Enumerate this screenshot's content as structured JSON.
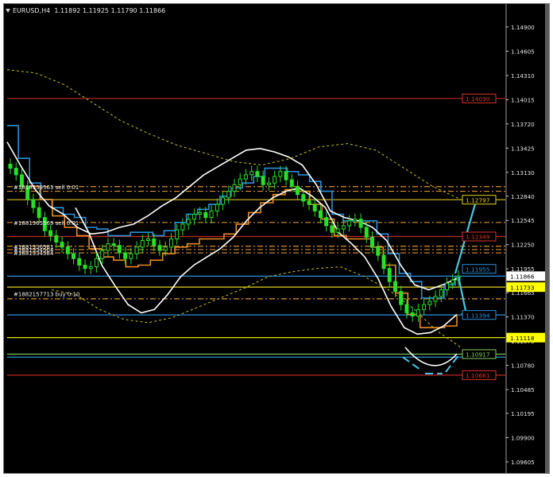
{
  "title_bar": {
    "symbol_label": "EURUSD,H4",
    "ohlc": "1.11892 1.11925 1.11790 1.11866"
  },
  "chart_data": {
    "type": "line",
    "title": "EURUSD,H4  1.11892 1.11925 1.11790 1.11866",
    "ylim": [
      1.0945,
      1.1518
    ],
    "grid": false,
    "background": "#000000",
    "y_ticks": [
      "1.14900",
      "1.14605",
      "1.14310",
      "1.14015",
      "1.13720",
      "1.13425",
      "1.13130",
      "1.12840",
      "1.12545",
      "1.12250",
      "1.11955",
      "1.11665",
      "1.11370",
      "1.11075",
      "1.10780",
      "1.10485",
      "1.10195",
      "1.09900",
      "1.09605"
    ],
    "y_tick_values": [
      1.149,
      1.14605,
      1.1431,
      1.14015,
      1.1372,
      1.13425,
      1.1313,
      1.1284,
      1.12545,
      1.1225,
      1.11955,
      1.11665,
      1.1137,
      1.11075,
      1.1078,
      1.10485,
      1.10195,
      1.099,
      1.09605
    ],
    "price_labels": [
      {
        "text": "1.14030",
        "value": 1.1403,
        "color": "#e0322a",
        "style": "box-outline"
      },
      {
        "text": "1.12797",
        "value": 1.12797,
        "color": "#e6d21a",
        "style": "box-outline"
      },
      {
        "text": "1.12349",
        "value": 1.12349,
        "color": "#e0322a",
        "style": "box-outline"
      },
      {
        "text": "1.11866",
        "value": 1.11866,
        "color": "#ffffff",
        "style": "filled-white"
      },
      {
        "text": "1.11733",
        "value": 1.11733,
        "color": "#ffff00",
        "style": "filled-yellow"
      },
      {
        "text": "1.11394",
        "value": 1.11394,
        "color": "#2a8fd8",
        "style": "box-outline"
      },
      {
        "text": "1.11118",
        "value": 1.11118,
        "color": "#ffff00",
        "style": "filled-yellow"
      },
      {
        "text": "1.10917",
        "value": 1.10917,
        "color": "#80d060",
        "style": "box-outline"
      },
      {
        "text": "1.10661",
        "value": 1.10661,
        "color": "#e0322a",
        "style": "box-outline"
      },
      {
        "text": "1.11955",
        "value": 1.11955,
        "color": "#2a8fd8",
        "style": "box-outline"
      }
    ],
    "horizontal_lines": [
      {
        "value": 1.1403,
        "color": "#c0281f",
        "dash": "solid"
      },
      {
        "value": 1.12956,
        "color": "#d89030",
        "dash": "dashdot"
      },
      {
        "value": 1.129,
        "color": "#d89030",
        "dash": "dashdot"
      },
      {
        "value": 1.12797,
        "color": "#d8c020",
        "dash": "solid"
      },
      {
        "value": 1.1252,
        "color": "#d89030",
        "dash": "dashdot"
      },
      {
        "value": 1.12349,
        "color": "#c0281f",
        "dash": "solid"
      },
      {
        "value": 1.1223,
        "color": "#d89030",
        "dash": "dashdot"
      },
      {
        "value": 1.1219,
        "color": "#d89030",
        "dash": "dashdot"
      },
      {
        "value": 1.1215,
        "color": "#d89030",
        "dash": "dashdot"
      },
      {
        "value": 1.11866,
        "color": "#2a8fd8",
        "dash": "solid"
      },
      {
        "value": 1.11733,
        "color": "#e6d21a",
        "dash": "solid"
      },
      {
        "value": 1.1159,
        "color": "#d89030",
        "dash": "dashdot"
      },
      {
        "value": 1.11394,
        "color": "#2a8fd8",
        "dash": "solid"
      },
      {
        "value": 1.11118,
        "color": "#ffff00",
        "dash": "solid"
      },
      {
        "value": 1.10917,
        "color": "#80d060",
        "dash": "solid"
      },
      {
        "value": 1.1088,
        "color": "#2a8fd8",
        "dash": "solid"
      },
      {
        "value": 1.10661,
        "color": "#c0281f",
        "dash": "solid"
      }
    ],
    "order_labels": [
      {
        "text": "#1818339563 sell 0.01",
        "value": 1.12956
      },
      {
        "text": "#1881365569 sell 0.01",
        "value": 1.1252
      },
      {
        "text": "#1881336581",
        "value": 1.1223
      },
      {
        "text": "#1881334504",
        "value": 1.1219
      },
      {
        "text": "#1881334584",
        "value": 1.1215
      },
      {
        "text": "#1882157713 buy 0.10",
        "value": 1.1165
      }
    ],
    "series": [
      {
        "name": "",
        "color": "#28e028",
        "kind": "candles",
        "close": [
          1.1318,
          1.131,
          1.1296,
          1.128,
          1.127,
          1.1258,
          1.1242,
          1.1236,
          1.1228,
          1.1222,
          1.1214,
          1.1208,
          1.12,
          1.1196,
          1.1198,
          1.1208,
          1.1218,
          1.1226,
          1.1224,
          1.1215,
          1.1208,
          1.1214,
          1.1222,
          1.123,
          1.1232,
          1.1224,
          1.1218,
          1.1222,
          1.1232,
          1.1243,
          1.125,
          1.1256,
          1.1262,
          1.1264,
          1.1258,
          1.1266,
          1.1274,
          1.1282,
          1.129,
          1.1298,
          1.1305,
          1.131,
          1.1314,
          1.1308,
          1.1298,
          1.13,
          1.1308,
          1.1314,
          1.1304,
          1.1296,
          1.1286,
          1.1278,
          1.1274,
          1.1266,
          1.1258,
          1.1248,
          1.124,
          1.1244,
          1.1248,
          1.1254,
          1.1256,
          1.1246,
          1.1234,
          1.1222,
          1.1212,
          1.1196,
          1.118,
          1.1168,
          1.1152,
          1.1142,
          1.1138,
          1.1146,
          1.1152,
          1.1156,
          1.1162,
          1.117,
          1.1178,
          1.1182,
          1.1187
        ]
      },
      {
        "name": "",
        "color": "#2a8fd8",
        "kind": "step",
        "values": [
          1.137,
          1.133,
          1.13,
          1.128,
          1.127,
          1.1262,
          1.1258,
          1.1246,
          1.1244,
          1.1236,
          1.1236,
          1.124,
          1.124,
          1.1236,
          1.1242,
          1.1252,
          1.1262,
          1.1268,
          1.1274,
          1.1284,
          1.1294,
          1.13,
          1.1308,
          1.1318,
          1.1318,
          1.1314,
          1.131,
          1.1302,
          1.129,
          1.1262,
          1.1254,
          1.1254,
          1.1254,
          1.1238,
          1.1214,
          1.119,
          1.118,
          1.116,
          1.116,
          1.1176,
          1.1186
        ]
      },
      {
        "name": "",
        "color": "#e88a24",
        "kind": "step",
        "values": [
          1.1296,
          1.128,
          1.126,
          1.1246,
          1.1236,
          1.122,
          1.121,
          1.1206,
          1.1198,
          1.12,
          1.1206,
          1.1214,
          1.1222,
          1.1226,
          1.1232,
          1.1232,
          1.1238,
          1.125,
          1.1264,
          1.1276,
          1.1286,
          1.1292,
          1.129,
          1.1274,
          1.1256,
          1.1236,
          1.1232,
          1.1232,
          1.1222,
          1.12,
          1.1166,
          1.114,
          1.1124,
          1.1124,
          1.1126,
          1.114
        ]
      },
      {
        "name": "",
        "color": "#ffffff",
        "kind": "band-upper",
        "values": [
          1.135,
          1.132,
          1.1292,
          1.1272,
          1.1262,
          1.1246,
          1.1238,
          1.124,
          1.1246,
          1.125,
          1.126,
          1.1272,
          1.1282,
          1.1296,
          1.131,
          1.132,
          1.133,
          1.134,
          1.1342,
          1.1338,
          1.1332,
          1.1322,
          1.1298,
          1.1266,
          1.1258,
          1.1254,
          1.1246,
          1.123,
          1.12,
          1.1176,
          1.117,
          1.1176,
          1.1184
        ]
      },
      {
        "name": "",
        "color": "#ffffff",
        "kind": "band-lower",
        "values": [
          1.127,
          1.124,
          1.12,
          1.1175,
          1.1152,
          1.1142,
          1.1146,
          1.1164,
          1.1186,
          1.12,
          1.121,
          1.122,
          1.1234,
          1.1254,
          1.127,
          1.1282,
          1.129,
          1.1294,
          1.1284,
          1.127,
          1.124,
          1.1226,
          1.121,
          1.1184,
          1.115,
          1.1124,
          1.1116,
          1.1118,
          1.1126,
          1.114
        ]
      },
      {
        "name": "",
        "color": "#c8c020",
        "kind": "dashed-envelope",
        "values": [
          1.1438,
          1.1434,
          1.142,
          1.1398,
          1.1376,
          1.136,
          1.1346,
          1.1336,
          1.1326,
          1.1322,
          1.133,
          1.1344,
          1.1348,
          1.134,
          1.1318,
          1.1296,
          1.128
        ]
      },
      {
        "name": "",
        "color": "#c8c020",
        "kind": "dashed-envelope-lower",
        "values": [
          1.117,
          1.1164,
          1.1146,
          1.1134,
          1.113,
          1.1136,
          1.1148,
          1.116,
          1.1172,
          1.1186,
          1.1192,
          1.1196,
          1.1198,
          1.1186,
          1.117,
          1.1148,
          1.112,
          1.11
        ]
      }
    ],
    "annotations": [
      {
        "type": "arrow",
        "color": "#48c8e8",
        "from": [
          1.119
        ],
        "to": [
          1.128
        ],
        "desc": "up"
      },
      {
        "type": "arrow",
        "color": "#48c8e8",
        "from": [
          1.119
        ],
        "to": [
          1.1138
        ],
        "desc": "down"
      }
    ]
  }
}
